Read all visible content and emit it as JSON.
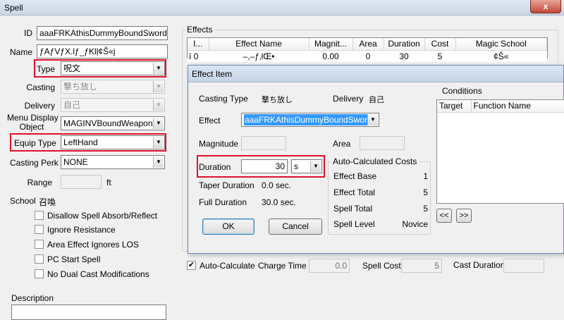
{
  "window": {
    "title": "Spell",
    "close_glyph": "x"
  },
  "spell": {
    "id_label": "ID",
    "id_value": "aaaFRKAthisDummyBoundSword",
    "name_label": "Name",
    "name_value": "ƒAƒVƒX.lƒ_ƒKlļ¢Š«j",
    "type_label": "Type",
    "type_value": "呪文",
    "casting_label": "Casting",
    "casting_value": "撃ち放し",
    "delivery_label": "Delivery",
    "delivery_value": "自己",
    "menu_display_label_1": "Menu Display",
    "menu_display_label_2": "Object",
    "menu_display_value": "MAGINVBoundWeapon",
    "equip_type_label": "Equip Type",
    "equip_type_value": "LeftHand",
    "casting_perk_label": "Casting Perk",
    "casting_perk_value": "NONE",
    "range_label": "Range",
    "range_value": "",
    "range_unit": "ft",
    "school_label": "School",
    "school_value": "召喚",
    "checkboxes": [
      {
        "label": "Disallow Spell Absorb/Reflect",
        "checked": false
      },
      {
        "label": "Ignore Resistance",
        "checked": false
      },
      {
        "label": "Area Effect Ignores LOS",
        "checked": false
      },
      {
        "label": "PC Start Spell",
        "checked": false
      },
      {
        "label": "No Dual Cast Modifications",
        "checked": false
      }
    ],
    "description_label": "Description",
    "description_value": ""
  },
  "effects": {
    "group_label": "Effects",
    "columns": [
      "I...",
      "Effect Name",
      "Magnit...",
      "Area",
      "Duration",
      "Cost",
      "Magic School"
    ],
    "rows": [
      {
        "marker": "ï",
        "index": "0",
        "name": "–,–ƒ‚lŒ•",
        "magnitude": "0.00",
        "area": "0",
        "duration": "30",
        "cost": "5",
        "school": "¢Š«"
      }
    ],
    "auto_calculate_label": "Auto-Calculate",
    "auto_calculate_checked": true,
    "auto_calculate_mark": "✔",
    "charge_time_label": "Charge Time",
    "charge_time_value": "0.0",
    "spell_cost_label": "Spell Cost",
    "spell_cost_value": "5",
    "cast_duration_label": "Cast Duration",
    "cast_duration_value": ""
  },
  "effect_item": {
    "title": "Effect Item",
    "casting_type_label": "Casting Type",
    "casting_type_value": "撃ち放し",
    "delivery_label": "Delivery",
    "delivery_value": "自己",
    "effect_label": "Effect",
    "effect_value": "aaaFRKAthisDummyBoundSwordLeft",
    "magnitude_label": "Magnitude",
    "magnitude_value": "",
    "area_label": "Area",
    "area_value": "",
    "duration_label": "Duration",
    "duration_value": "30",
    "duration_unit": "s",
    "taper_duration_label": "Taper Duration",
    "taper_duration_value": "0.0 sec.",
    "full_duration_label": "Full Duration",
    "full_duration_value": "30.0 sec.",
    "costs_group_label": "Auto-Calculated Costs",
    "effect_base_label": "Effect Base",
    "effect_base_value": "1",
    "effect_total_label": "Effect Total",
    "effect_total_value": "5",
    "spell_total_label": "Spell Total",
    "spell_total_value": "5",
    "spell_level_label": "Spell Level",
    "spell_level_value": "Novice",
    "ok_label": "OK",
    "cancel_label": "Cancel",
    "conditions_label": "Conditions",
    "conditions_columns": [
      "Target",
      "Function Name"
    ],
    "prev_label": "<<",
    "next_label": ">>"
  },
  "colors": {
    "highlight": "#e0102b",
    "selection": "#3399ff"
  }
}
